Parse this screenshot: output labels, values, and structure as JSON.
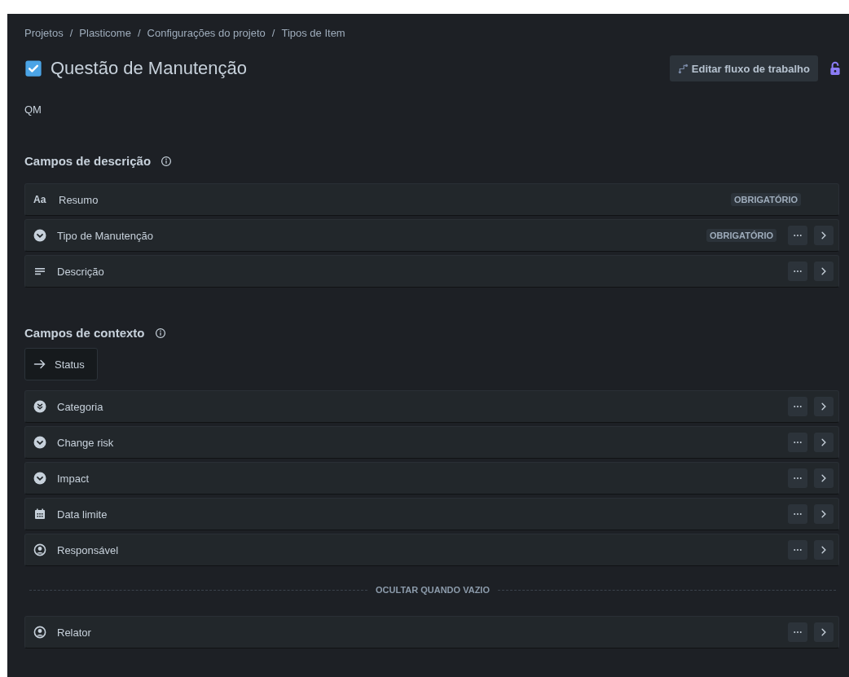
{
  "breadcrumb": {
    "items": [
      "Projetos",
      "Plasticome",
      "Configurações do projeto",
      "Tipos de Item"
    ],
    "separators": [
      "/",
      "/",
      "/"
    ]
  },
  "header": {
    "title": "Questão de Manutenção",
    "key": "QM",
    "edit_workflow_button": "Editar fluxo de trabalho",
    "locked": false
  },
  "description_section": {
    "title": "Campos de descrição",
    "fields": [
      {
        "label": "Resumo",
        "kind": "text",
        "glyph": "Aa",
        "badge": "OBRIGATÓRIO",
        "actions": false
      },
      {
        "label": "Tipo de Manutenção",
        "kind": "select",
        "badge": "OBRIGATÓRIO",
        "actions": true
      },
      {
        "label": "Descrição",
        "kind": "paragraph",
        "actions": true
      }
    ]
  },
  "context_section": {
    "title": "Campos de contexto",
    "status": "Status",
    "fields": [
      {
        "label": "Categoria",
        "kind": "multiselect",
        "actions": true
      },
      {
        "label": "Change risk",
        "kind": "select",
        "actions": true
      },
      {
        "label": "Impact",
        "kind": "select",
        "actions": true
      },
      {
        "label": "Data limite",
        "kind": "date",
        "actions": true
      },
      {
        "label": "Responsável",
        "kind": "user",
        "actions": true
      }
    ],
    "hide_when_empty": {
      "label": "OCULTAR QUANDO VAZIO",
      "fields": [
        {
          "label": "Relator",
          "kind": "user",
          "actions": true
        }
      ]
    }
  }
}
